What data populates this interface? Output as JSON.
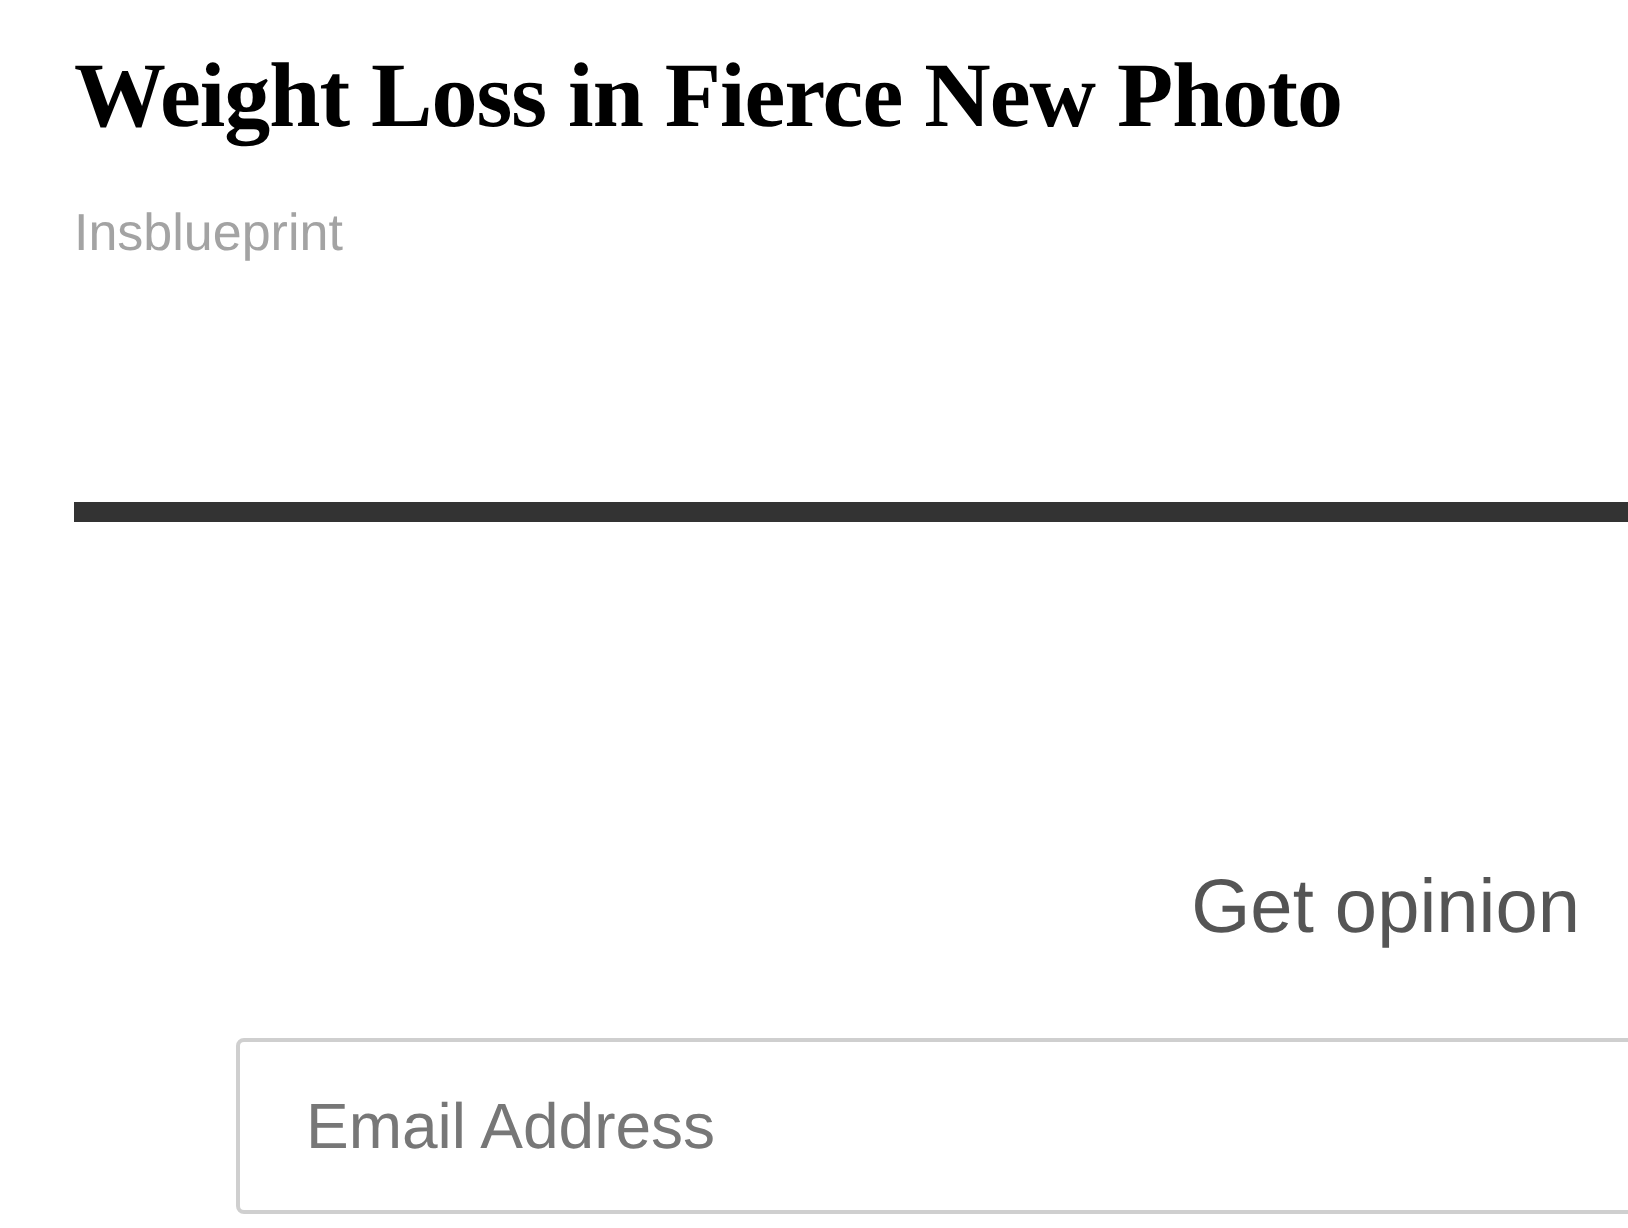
{
  "article": {
    "headline": "Weight Loss in Fierce New Photo",
    "source": "Insblueprint"
  },
  "newsletter": {
    "heading": "Get opinion",
    "email_field": {
      "placeholder": "Email Address"
    }
  }
}
